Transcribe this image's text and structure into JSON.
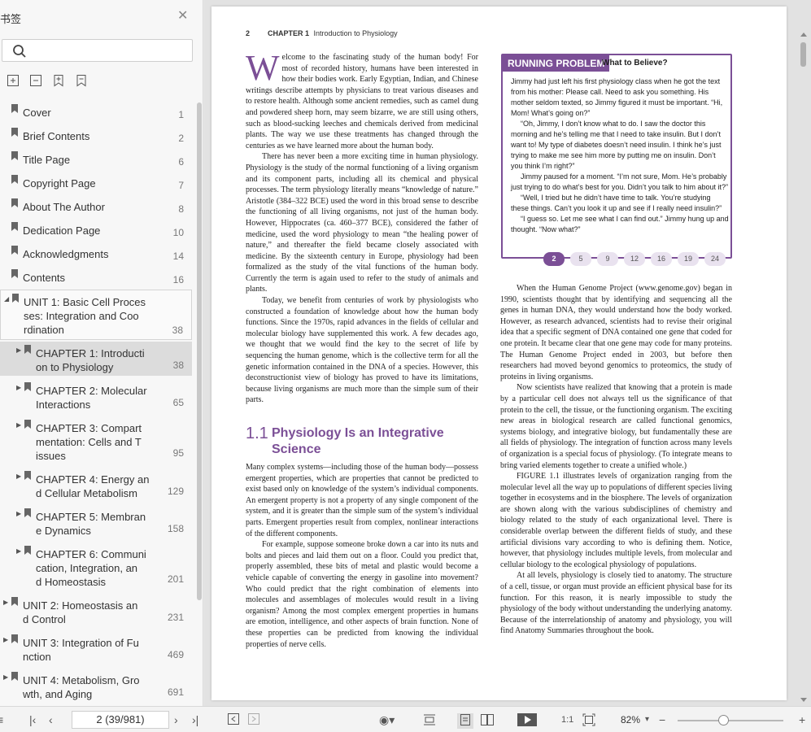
{
  "sidebar": {
    "title": "书签",
    "bookmarks": [
      {
        "label": "Cover",
        "page": "1"
      },
      {
        "label": "Brief Contents",
        "page": "2"
      },
      {
        "label": "Title Page",
        "page": "6"
      },
      {
        "label": "Copyright Page",
        "page": "7"
      },
      {
        "label": "About The Author",
        "page": "8"
      },
      {
        "label": "Dedication Page",
        "page": "10"
      },
      {
        "label": "Acknowledgments",
        "page": "14"
      },
      {
        "label": "Contents",
        "page": "16"
      },
      {
        "label": "UNIT 1: Basic Cell Processes: Integration and Coordination",
        "lines": [
          "UNIT 1: Basic Cell Proces",
          "ses: Integration and Coo",
          "rdination"
        ],
        "page": "38"
      },
      {
        "lines": [
          "CHAPTER 1: Introducti",
          "on to Physiology"
        ],
        "page": "38"
      },
      {
        "lines": [
          "CHAPTER 2: Molecular",
          "Interactions"
        ],
        "page": "65"
      },
      {
        "lines": [
          "CHAPTER 3: Compart",
          "mentation: Cells and T",
          "issues"
        ],
        "page": "95"
      },
      {
        "lines": [
          "CHAPTER 4: Energy an",
          "d Cellular Metabolism"
        ],
        "page": "129"
      },
      {
        "lines": [
          "CHAPTER 5: Membran",
          "e Dynamics"
        ],
        "page": "158"
      },
      {
        "lines": [
          "CHAPTER 6: Communi",
          "cation, Integration, an",
          "d Homeostasis"
        ],
        "page": "201"
      },
      {
        "lines": [
          "UNIT 2: Homeostasis an",
          "d Control"
        ],
        "page": "231"
      },
      {
        "lines": [
          "UNIT 3: Integration of Fu",
          "nction"
        ],
        "page": "469"
      },
      {
        "lines": [
          "UNIT 4: Metabolism, Gro",
          "wth, and Aging"
        ],
        "page": "691"
      }
    ]
  },
  "page": {
    "header_num": "2",
    "header_chapter": "CHAPTER 1",
    "header_title": "Introduction to Physiology",
    "dropcap": "W",
    "left_paras": [
      "elcome to the fascinating study of the human body! For most of recorded history, humans have been interested in how their bodies work. Early Egyptian, Indian, and Chinese writings describe attempts by physicians to treat various diseases and to restore health. Although some ancient remedies, such as camel dung and powdered sheep horn, may seem bizarre, we are still using others, such as blood-sucking leeches and chemicals derived from medicinal plants. The way we use these treatments has changed through the centuries as we have learned more about the human body.",
      "There has never been a more exciting time in human physiology. Physiology is the study of the normal functioning of a living organism and its component parts, including all its chemical and physical processes. The term physiology literally means “knowledge of nature.” Aristotle (384–322 BCE) used the word in this broad sense to describe the functioning of all living organisms, not just of the human body. However, Hippocrates (ca. 460–377 BCE), considered the father of medicine, used the word physiology to mean “the healing power of nature,” and thereafter the field became closely associated with medicine. By the sixteenth century in Europe, physiology had been formalized as the study of the vital functions of the human body. Currently the term is again used to refer to the study of animals and plants.",
      "Today, we benefit from centuries of work by physiologists who constructed a foundation of knowledge about how the human body functions. Since the 1970s, rapid advances in the fields of cellular and molecular biology have supplemented this work. A few decades ago, we thought that we would find the key to the secret of life by sequencing the human genome, which is the collective term for all the genetic information contained in the DNA of a species. However, this deconstructionist view of biology has proved to have its limitations, because living organisms are much more than the simple sum of their parts."
    ],
    "section_num": "1.1",
    "section_title": "Physiology Is an Integrative Science",
    "left_paras2": [
      "Many complex systems—including those of the human body—possess emergent properties, which are properties that cannot be predicted to exist based only on knowledge of the system’s individual components. An emergent property is not a property of any single component of the system, and it is greater than the simple sum of the system’s individual parts. Emergent properties result from complex, nonlinear interactions of the different components.",
      "For example, suppose someone broke down a car into its nuts and bolts and pieces and laid them out on a floor. Could you predict that, properly assembled, these bits of metal and plastic would become a vehicle capable of converting the energy in gasoline into movement? Who could predict that the right combination of elements into molecules and assemblages of molecules would result in a living organism? Among the most complex emergent properties in humans are emotion, intelligence, and other aspects of brain function. None of these properties can be predicted from knowing the individual properties of nerve cells."
    ],
    "running_problem": {
      "tag": "RUNNING PROBLEM",
      "heading": "What to Believe?",
      "paras": [
        "Jimmy had just left his first physiology class when he got the text from his mother: Please call. Need to ask you something. His mother seldom texted, so Jimmy figured it must be important. “Hi, Mom! What’s going on?”",
        "“Oh, Jimmy, I don’t know what to do. I saw the doctor this morning and he’s telling me that I need to take insulin. But I don’t want to! My type of diabetes doesn’t need insulin. I think he’s just trying to make me see him more by putting me on insulin. Don’t you think I’m right?”",
        "Jimmy paused for a moment. “I’m not sure, Mom. He’s probably just trying to do what’s best for you. Didn’t you talk to him about it?”",
        "“Well, I tried but he didn’t have time to talk. You’re studying these things. Can’t you look it up and see if I really need insulin?”",
        "“I guess so. Let me see what I can find out.” Jimmy hung up and thought. “Now what?”"
      ],
      "pages": [
        "2",
        "5",
        "9",
        "12",
        "16",
        "19",
        "24"
      ]
    },
    "right_paras": [
      "When the Human Genome Project (www.genome.gov) began in 1990, scientists thought that by identifying and sequencing all the genes in human DNA, they would understand how the body worked. However, as research advanced, scientists had to revise their original idea that a specific segment of DNA contained one gene that coded for one protein. It became clear that one gene may code for many proteins. The Human Genome Project ended in 2003, but before then researchers had moved beyond genomics to proteomics, the study of proteins in living organisms.",
      "Now scientists have realized that knowing that a protein is made by a particular cell does not always tell us the significance of that protein to the cell, the tissue, or the functioning organism. The exciting new areas in biological research are called functional genomics, systems biology, and integrative biology, but fundamentally these are all fields of physiology. The integration of function across many levels of organization is a special focus of physiology. (To integrate means to bring varied elements together to create a unified whole.)",
      "FIGURE 1.1 illustrates levels of organization ranging from the molecular level all the way up to populations of different species living together in ecosystems and in the biosphere. The levels of organization are shown along with the various subdisciplines of chemistry and biology related to the study of each organizational level. There is considerable overlap between the different fields of study, and these artificial divisions vary according to who is defining them. Notice, however, that physiology includes multiple levels, from molecular and cellular biology to the ecological physiology of populations.",
      "At all levels, physiology is closely tied to anatomy. The structure of a cell, tissue, or organ must provide an efficient physical base for its function. For this reason, it is nearly impossible to study the physiology of the body without understanding the underlying anatomy. Because of the interrelationship of anatomy and physiology, you will find Anatomy Summaries throughout the book."
    ]
  },
  "toolbar": {
    "page_indicator": "2 (39/981)",
    "zoom": "82%",
    "zoom_level": 0.43
  },
  "colors": {
    "accent": "#7b4f96"
  }
}
